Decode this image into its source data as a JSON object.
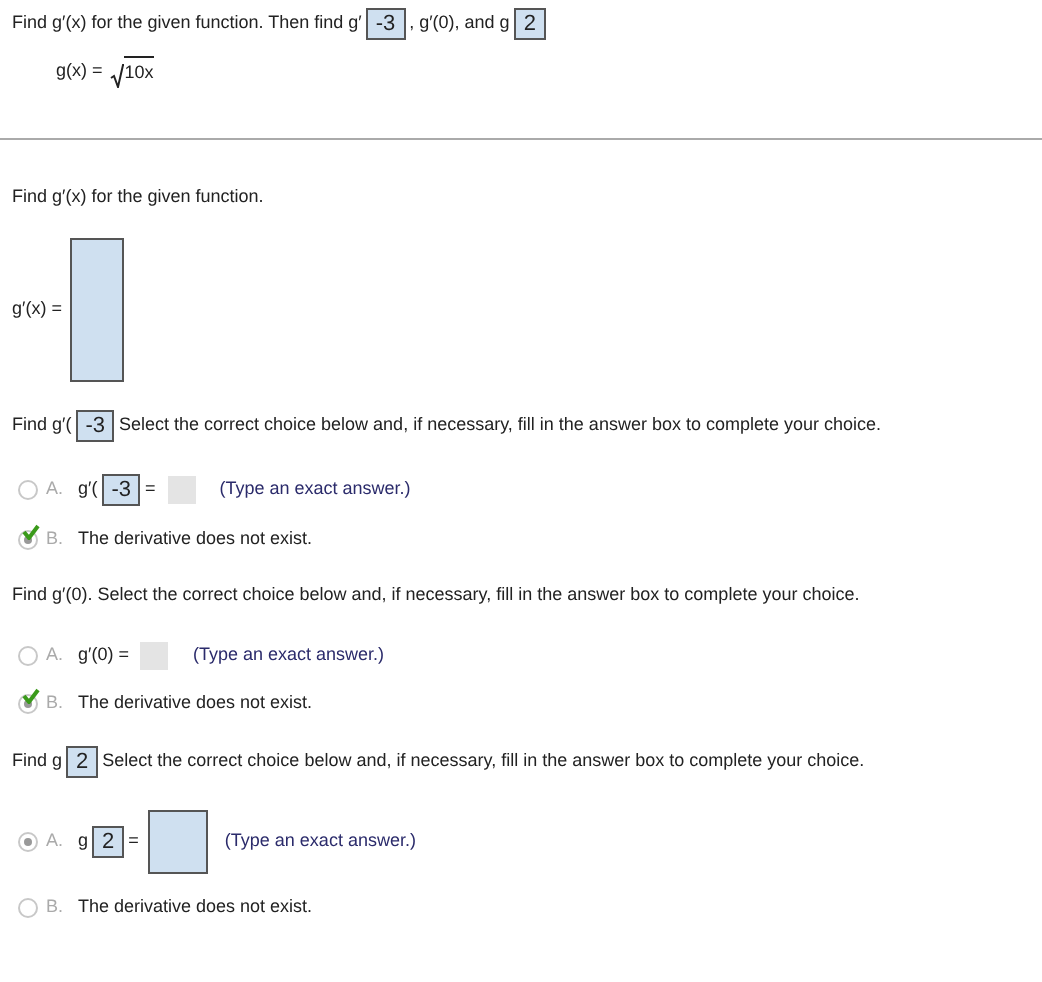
{
  "header": {
    "prompt": [
      {
        "kind": "text",
        "text": "Find g′(x) for the given function. Then find g′"
      },
      {
        "kind": "box",
        "text": "-3"
      },
      {
        "kind": "text",
        "text": ", g′(0), and g"
      },
      {
        "kind": "box",
        "text": "2"
      }
    ],
    "formula": {
      "lhs": "g(x) =",
      "radicand": "10x"
    }
  },
  "parts": [
    {
      "prompt": [
        {
          "kind": "text",
          "text": "Find g′(x) for the given function."
        }
      ],
      "answer": {
        "label": "g′(x) ="
      }
    },
    {
      "prompt": [
        {
          "kind": "text",
          "text": "Find g′("
        },
        {
          "kind": "box",
          "text": "-3"
        },
        {
          "kind": "text",
          "text": "Select the correct choice below and, if necessary, fill in the answer box to complete your choice."
        }
      ],
      "choices": [
        {
          "letter": "A.",
          "selected": false,
          "correct": false,
          "content": [
            {
              "kind": "text",
              "text": "g′("
            },
            {
              "kind": "box",
              "text": "-3"
            },
            {
              "kind": "text",
              "text": "="
            },
            {
              "kind": "blank"
            },
            {
              "kind": "hint",
              "text": "(Type an exact answer.)"
            }
          ]
        },
        {
          "letter": "B.",
          "selected": true,
          "correct": true,
          "content": [
            {
              "kind": "text",
              "text": "The derivative does not exist."
            }
          ]
        }
      ]
    },
    {
      "prompt": [
        {
          "kind": "text",
          "text": "Find g′(0). Select the correct choice below and, if necessary, fill in the answer box to complete your choice."
        }
      ],
      "choices": [
        {
          "letter": "A.",
          "selected": false,
          "correct": false,
          "content": [
            {
              "kind": "text",
              "text": "g′(0) ="
            },
            {
              "kind": "blank"
            },
            {
              "kind": "hint",
              "text": "(Type an exact answer.)"
            }
          ]
        },
        {
          "letter": "B.",
          "selected": true,
          "correct": true,
          "content": [
            {
              "kind": "text",
              "text": "The derivative does not exist."
            }
          ]
        }
      ]
    },
    {
      "prompt": [
        {
          "kind": "text",
          "text": "Find g"
        },
        {
          "kind": "box",
          "text": "2"
        },
        {
          "kind": "text",
          "text": "Select the correct choice below and, if necessary, fill in the answer box to complete your choice."
        }
      ],
      "choices": [
        {
          "letter": "A.",
          "selected": true,
          "correct": false,
          "content": [
            {
              "kind": "text",
              "text": "g"
            },
            {
              "kind": "box",
              "text": "2"
            },
            {
              "kind": "text",
              "text": "="
            },
            {
              "kind": "field"
            },
            {
              "kind": "hint",
              "text": "(Type an exact answer.)"
            }
          ]
        },
        {
          "letter": "B.",
          "selected": false,
          "correct": false,
          "content": [
            {
              "kind": "text",
              "text": "The derivative does not exist."
            }
          ]
        }
      ]
    }
  ]
}
